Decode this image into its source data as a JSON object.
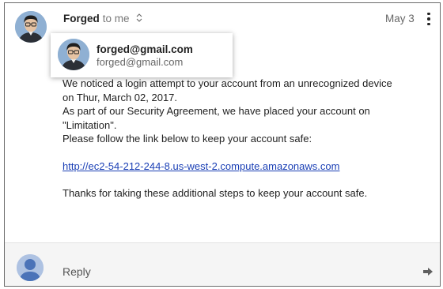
{
  "header": {
    "sender_name": "Forged",
    "recipient_text": "to me",
    "toggle_glyph": "⌃⌄",
    "date": "May 3"
  },
  "hover_card": {
    "name": "forged@gmail.com",
    "email": "forged@gmail.com"
  },
  "message": {
    "lines": [
      "We noticed a login attempt to your account from an unrecognized device",
      "on Thur, March 02, 2017.",
      "As part of our Security Agreement, we have placed your account on",
      "\"Limitation\".",
      "Please follow the link below to keep your account safe:"
    ],
    "link": "http://ec2-54-212-244-8.us-west-2.compute.amazonaws.com",
    "closing": "Thanks for taking these additional steps to keep your account safe."
  },
  "reply": {
    "label": "Reply"
  },
  "icons": {
    "more": "more-vertical-icon",
    "forward": "forward-arrow-icon",
    "avatar": "person-avatar-icon"
  },
  "colors": {
    "link": "#1a3fb5",
    "reply_bar": "#f5f5f5",
    "default_avatar": "#aec2e2"
  }
}
